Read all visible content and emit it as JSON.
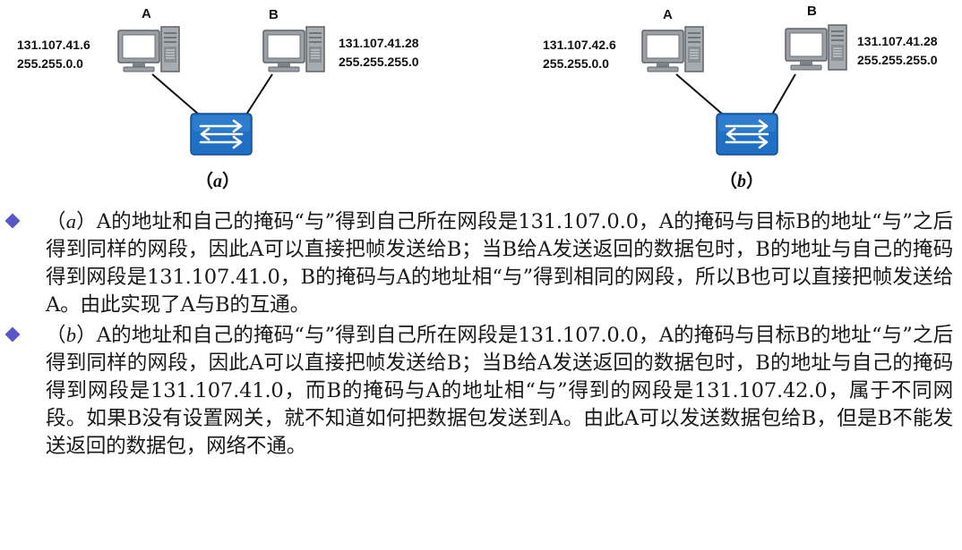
{
  "diagram_a": {
    "host_a": {
      "label": "A",
      "ip": "131.107.41.6",
      "mask": "255.255.0.0"
    },
    "host_b": {
      "label": "B",
      "ip": "131.107.41.28",
      "mask": "255.255.255.0"
    },
    "caption": "（a）"
  },
  "diagram_b": {
    "host_a": {
      "label": "A",
      "ip": "131.107.42.6",
      "mask": "255.255.0.0"
    },
    "host_b": {
      "label": "B",
      "ip": "131.107.41.28",
      "mask": "255.255.255.0"
    },
    "caption": "（b）"
  },
  "colors": {
    "switch": "#1f6fc4",
    "bullet": "#5a56c9",
    "pc_body": "#8a8f94"
  },
  "icons": {
    "pc": "desktop-computer-icon",
    "switch": "network-switch-icon",
    "bullet": "diamond-bullet-icon"
  },
  "paragraphs": [
    "（a）A的地址和自己的掩码“与”得到自己所在网段是131.107.0.0，A的掩码与目标B的地址“与”之后得到同样的网段，因此A可以直接把帧发送给B；当B给A发送返回的数据包时，B的地址与自己的掩码得到网段是131.107.41.0，B的掩码与A的地址相“与”得到相同的网段，所以B也可以直接把帧发送给A。由此实现了A与B的互通。",
    "（b）A的地址和自己的掩码“与”得到自己所在网段是131.107.0.0，A的掩码与目标B的地址“与”之后得到同样的网段，因此A可以直接把帧发送给B；当B给A发送返回的数据包时，B的地址与自己的掩码得到网段是131.107.41.0，而B的掩码与A的地址相“与”得到的网段是131.107.42.0，属于不同网段。如果B没有设置网关，就不知道如何把数据包发送到A。由此A可以发送数据包给B，但是B不能发送返回的数据包，网络不通。"
  ]
}
